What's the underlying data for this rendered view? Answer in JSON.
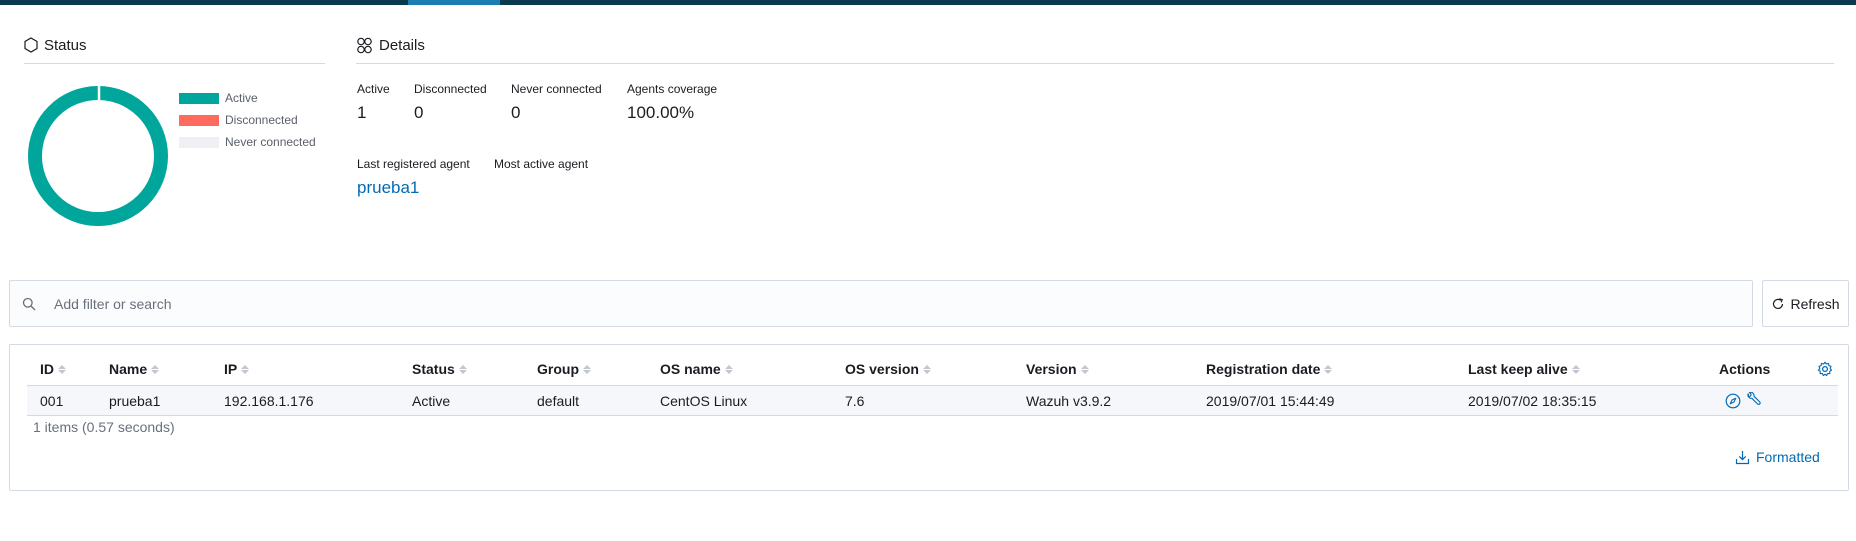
{
  "colors": {
    "active": "#00a69b",
    "disconnected": "#ff6b5f",
    "never_connected": "#eef0f3",
    "link": "#006bb4"
  },
  "status": {
    "title": "Status",
    "legend": [
      {
        "label": "Active",
        "color": "#00a69b"
      },
      {
        "label": "Disconnected",
        "color": "#ff6b5f"
      },
      {
        "label": "Never connected",
        "color": "#eef0f3"
      }
    ],
    "chart_values": {
      "active": 1,
      "disconnected": 0,
      "never_connected": 0
    }
  },
  "details": {
    "title": "Details",
    "active_label": "Active",
    "active_value": "1",
    "disconnected_label": "Disconnected",
    "disconnected_value": "0",
    "never_label": "Never connected",
    "never_value": "0",
    "coverage_label": "Agents coverage",
    "coverage_value": "100.00%",
    "last_registered_label": "Last registered agent",
    "last_registered_value": "prueba1",
    "most_active_label": "Most active agent"
  },
  "search": {
    "placeholder": "Add filter or search",
    "refresh_label": "Refresh"
  },
  "table": {
    "headers": [
      "ID",
      "Name",
      "IP",
      "Status",
      "Group",
      "OS name",
      "OS version",
      "Version",
      "Registration date",
      "Last keep alive",
      "Actions"
    ],
    "rows": [
      [
        "001",
        "prueba1",
        "192.168.1.176",
        "Active",
        "default",
        "CentOS Linux",
        "7.6",
        "Wazuh v3.9.2",
        "2019/07/01 15:44:49",
        "2019/07/02 18:35:15"
      ]
    ],
    "items_count": "1 items (0.57 seconds)",
    "formatted_label": "Formatted"
  }
}
